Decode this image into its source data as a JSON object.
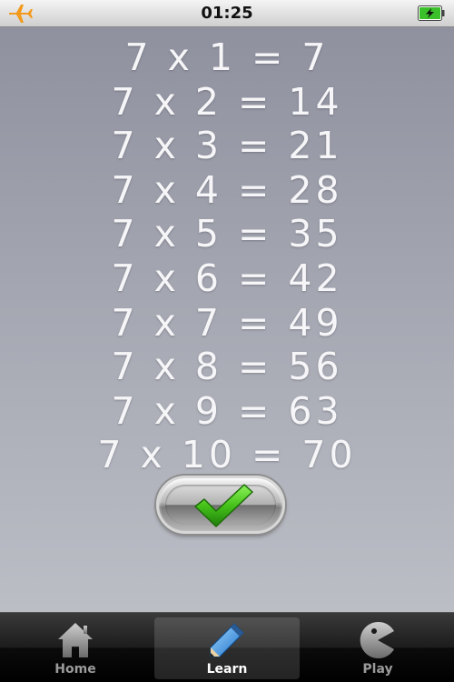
{
  "status_bar": {
    "time": "01:25",
    "airplane_icon": "airplane-icon",
    "battery_icon": "battery-charging-icon"
  },
  "multiplication_table": {
    "rows": [
      "7 x 1 = 7",
      "7 x 2 = 14",
      "7 x 3 = 21",
      "7 x 4 = 28",
      "7 x 5 = 35",
      "7 x 6 = 42",
      "7 x 7 = 49",
      "7 x 8 = 56",
      "7 x 9 = 63",
      "7 x 10 = 70"
    ]
  },
  "check_button": {
    "icon": "checkmark-icon",
    "color": "#46c21a"
  },
  "tab_bar": {
    "selected": "Learn",
    "tabs": [
      {
        "label": "Home",
        "icon": "home-icon"
      },
      {
        "label": "Learn",
        "icon": "pencil-icon"
      },
      {
        "label": "Play",
        "icon": "pacman-icon"
      }
    ]
  },
  "colors": {
    "status_airplane": "#f39a1c",
    "battery_fill": "#3bbf2a",
    "text": "#f6f6f8"
  }
}
